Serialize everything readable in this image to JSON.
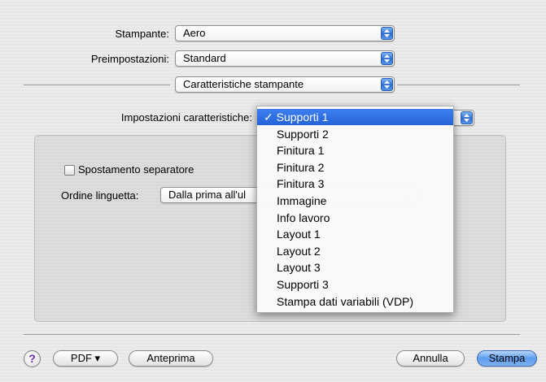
{
  "printer": {
    "label": "Stampante:",
    "value": "Aero"
  },
  "presets": {
    "label": "Preimpostazioni:",
    "value": "Standard"
  },
  "section": {
    "value": "Caratteristiche stampante"
  },
  "feature_settings": {
    "label": "Impostazioni caratteristiche:"
  },
  "panel": {
    "separator_checkbox_label": "Spostamento separatore",
    "tab_order_label": "Ordine linguetta:",
    "tab_order_value": "Dalla prima all'ul"
  },
  "menu": {
    "items": [
      "✓ Supporti 1",
      "Supporti 2",
      "Finitura 1",
      "Finitura 2",
      "Finitura 3",
      "Immagine",
      "Info lavoro",
      "Layout 1",
      "Layout 2",
      "Layout 3",
      "Supporti 3",
      "Stampa dati variabili (VDP)"
    ]
  },
  "footer": {
    "help_label": "?",
    "pdf_label": "PDF ▾",
    "preview_label": "Anteprima",
    "cancel_label": "Annulla",
    "print_label": "Stampa"
  }
}
